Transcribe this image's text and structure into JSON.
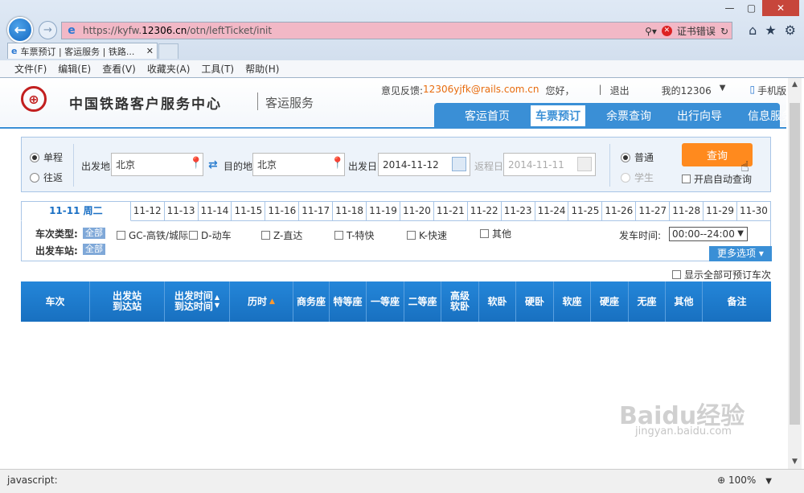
{
  "browser": {
    "url_prefix": "https://kyfw.",
    "url_host": "12306.cn",
    "url_path": "/otn/leftTicket/init",
    "cert_error": "证书错误",
    "tab_title": "车票预订 | 客运服务 | 铁路...",
    "menu": [
      "文件(F)",
      "编辑(E)",
      "查看(V)",
      "收藏夹(A)",
      "工具(T)",
      "帮助(H)"
    ]
  },
  "header": {
    "logo_text": "中国铁路客户服务中心",
    "logo_sub": "客运服务",
    "feedback_label": "意见反馈:",
    "feedback_email": "12306yjfk@rails.com.cn",
    "greeting": "您好，",
    "logout": "退出",
    "my12306": "我的12306",
    "mobile": "手机版"
  },
  "nav": {
    "items": [
      "客运首页",
      "车票预订",
      "余票查询",
      "出行向导",
      "信息服务"
    ],
    "active_index": 1
  },
  "search": {
    "one_way": "单程",
    "round_trip": "往返",
    "from_label": "出发地",
    "from_value": "北京",
    "to_label": "目的地",
    "to_value": "北京",
    "depart_label": "出发日",
    "depart_value": "2014-11-12",
    "return_label": "返程日",
    "return_value": "2014-11-11",
    "normal": "普通",
    "student": "学生",
    "query_button": "查询",
    "auto_query": "开启自动查询"
  },
  "date_tabs": [
    "11-11 周二",
    "11-12",
    "11-13",
    "11-14",
    "11-15",
    "11-16",
    "11-17",
    "11-18",
    "11-19",
    "11-20",
    "11-21",
    "11-22",
    "11-23",
    "11-24",
    "11-25",
    "11-26",
    "11-27",
    "11-28",
    "11-29",
    "11-30"
  ],
  "filters": {
    "train_type_label": "车次类型:",
    "all": "全部",
    "types": [
      "GC-高铁/城际",
      "D-动车",
      "Z-直达",
      "T-特快",
      "K-快速",
      "其他"
    ],
    "station_label": "出发车站:",
    "time_label": "发车时间:",
    "time_value": "00:00--24:00",
    "more_options": "更多选项",
    "show_all": "显示全部可预订车次"
  },
  "table": {
    "headers": [
      "车次",
      "出发站\n到达站",
      "出发时间\n到达时间",
      "历时",
      "商务座",
      "特等座",
      "一等座",
      "二等座",
      "高级\n软卧",
      "软卧",
      "硬卧",
      "软座",
      "硬座",
      "无座",
      "其他",
      "备注"
    ]
  },
  "status": {
    "text": "javascript:",
    "zoom": "100%"
  },
  "watermark": {
    "main": "Baidu经验",
    "sub": "jingyan.baidu.com"
  }
}
